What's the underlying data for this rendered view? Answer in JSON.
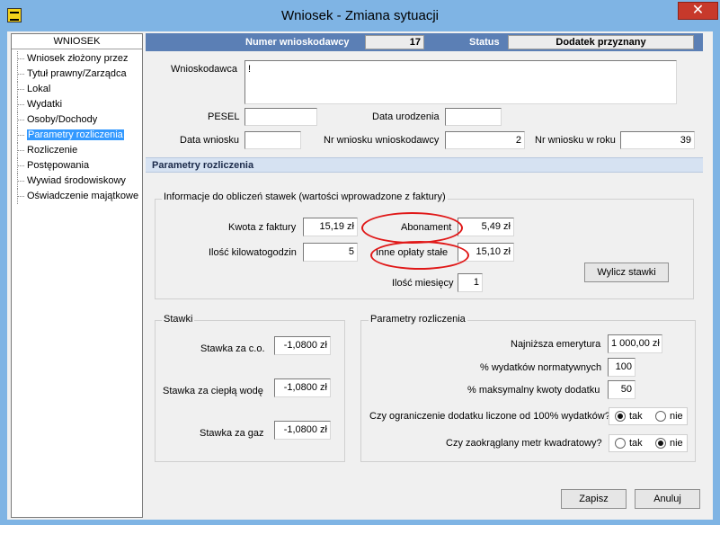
{
  "window": {
    "title": "Wniosek - Zmiana sytuacji",
    "close_label": "✕"
  },
  "sidebar": {
    "header": "WNIOSEK",
    "items": [
      {
        "label": "Wniosek złożony przez"
      },
      {
        "label": "Tytuł prawny/Zarządca"
      },
      {
        "label": "Lokal"
      },
      {
        "label": "Wydatki"
      },
      {
        "label": "Osoby/Dochody"
      },
      {
        "label": "Parametry rozliczenia",
        "selected": true
      },
      {
        "label": "Rozliczenie"
      },
      {
        "label": "Postępowania"
      },
      {
        "label": "Wywiad środowiskowy"
      },
      {
        "label": "Oświadczenie majątkowe"
      }
    ]
  },
  "header": {
    "applicant_no_label": "Numer wnioskodawcy",
    "applicant_no_value": "17",
    "status_label": "Status",
    "status_value": "Dodatek przyznany"
  },
  "form": {
    "applicant_label": "Wnioskodawca",
    "applicant_value": "!",
    "pesel_label": "PESEL",
    "pesel_value": "",
    "birth_date_label": "Data urodzenia",
    "birth_date_value": "",
    "app_date_label": "Data wniosku",
    "app_date_value": "",
    "app_no_applicant_label": "Nr wniosku wnioskodawcy",
    "app_no_applicant_value": "2",
    "app_no_year_label": "Nr wniosku w roku",
    "app_no_year_value": "39"
  },
  "section_title": "Parametry rozliczenia",
  "invoice_group": {
    "title": "Informacje do obliczeń stawek (wartości wprowadzone z faktury)",
    "invoice_amount_label": "Kwota z faktury",
    "invoice_amount_value": "15,19 zł",
    "subscription_label": "Abonament",
    "subscription_value": "5,49 zł",
    "kwh_label": "Ilość kilowatogodzin",
    "kwh_value": "5",
    "other_fees_label": "Inne opłaty stałe",
    "other_fees_value": "15,10 zł",
    "months_label": "Ilość miesięcy",
    "months_value": "1",
    "calc_button": "Wylicz stawki"
  },
  "rates_group": {
    "title": "Stawki",
    "rates": [
      {
        "label": "Stawka za c.o.",
        "value": "-1,0800 zł"
      },
      {
        "label": "Stawka za ciepłą wodę",
        "value": "-1,0800 zł"
      },
      {
        "label": "Stawka za gaz",
        "value": "-1,0800 zł"
      }
    ]
  },
  "params_group": {
    "title": "Parametry rozliczenia",
    "min_pension_label": "Najniższa emerytura",
    "min_pension_value": "1 000,00 zł",
    "norm_expenses_label": "% wydatków normatywnych",
    "norm_expenses_value": "100",
    "max_allowance_label": "% maksymalny kwoty dodatku",
    "max_allowance_value": "50",
    "limit_question": "Czy ograniczenie dodatku liczone od 100% wydatków?",
    "limit_selected": "tak",
    "round_question": "Czy zaokrąglany metr kwadratowy?",
    "round_selected": "nie",
    "yes_label": "tak",
    "no_label": "nie"
  },
  "footer": {
    "save_label": "Zapisz",
    "cancel_label": "Anuluj"
  },
  "colors": {
    "title_bar": "#7fb4e4",
    "header_bar": "#5b7fb5",
    "selection": "#3399ff",
    "annotation": "#e01818"
  }
}
